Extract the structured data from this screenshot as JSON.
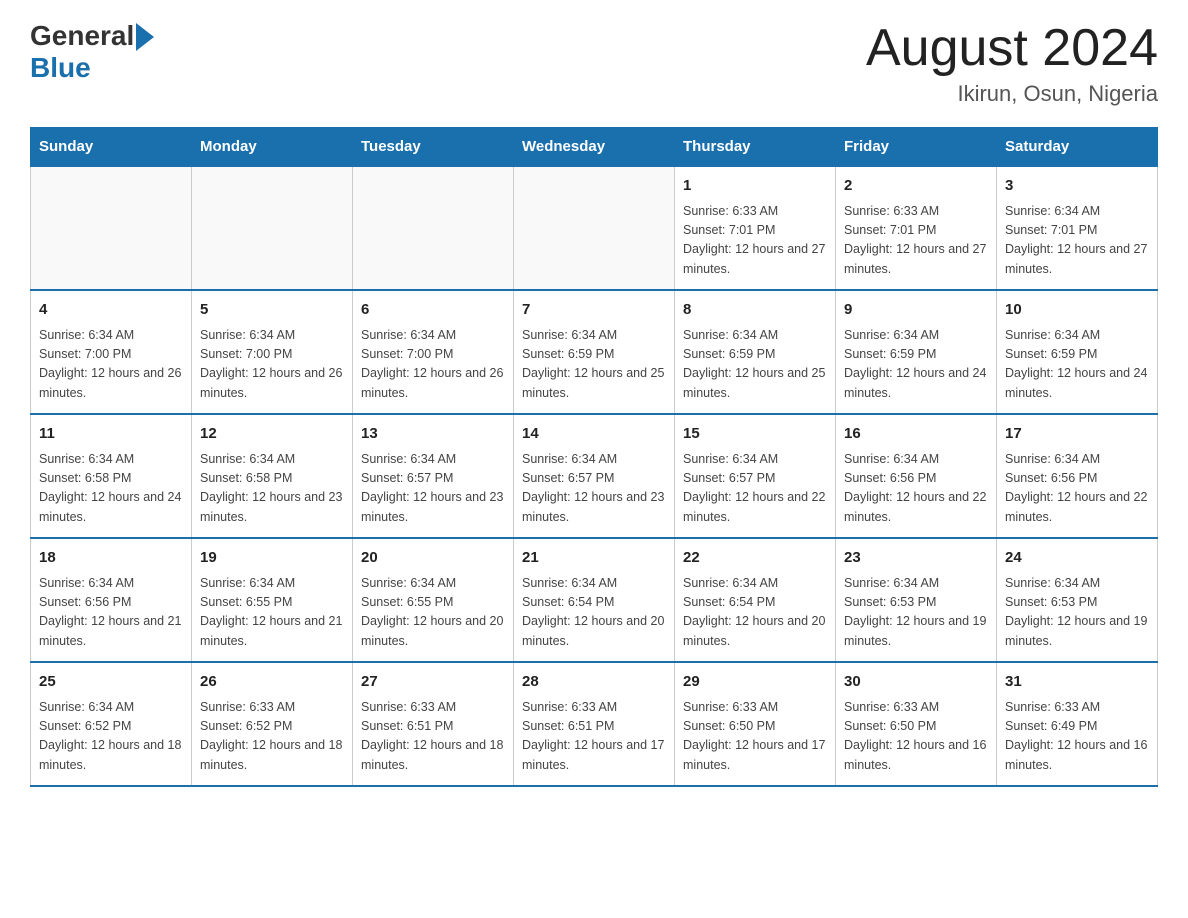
{
  "header": {
    "logo_general": "General",
    "logo_blue": "Blue",
    "title": "August 2024",
    "subtitle": "Ikirun, Osun, Nigeria"
  },
  "calendar": {
    "days_of_week": [
      "Sunday",
      "Monday",
      "Tuesday",
      "Wednesday",
      "Thursday",
      "Friday",
      "Saturday"
    ],
    "weeks": [
      [
        {
          "day": "",
          "info": ""
        },
        {
          "day": "",
          "info": ""
        },
        {
          "day": "",
          "info": ""
        },
        {
          "day": "",
          "info": ""
        },
        {
          "day": "1",
          "info": "Sunrise: 6:33 AM\nSunset: 7:01 PM\nDaylight: 12 hours and 27 minutes."
        },
        {
          "day": "2",
          "info": "Sunrise: 6:33 AM\nSunset: 7:01 PM\nDaylight: 12 hours and 27 minutes."
        },
        {
          "day": "3",
          "info": "Sunrise: 6:34 AM\nSunset: 7:01 PM\nDaylight: 12 hours and 27 minutes."
        }
      ],
      [
        {
          "day": "4",
          "info": "Sunrise: 6:34 AM\nSunset: 7:00 PM\nDaylight: 12 hours and 26 minutes."
        },
        {
          "day": "5",
          "info": "Sunrise: 6:34 AM\nSunset: 7:00 PM\nDaylight: 12 hours and 26 minutes."
        },
        {
          "day": "6",
          "info": "Sunrise: 6:34 AM\nSunset: 7:00 PM\nDaylight: 12 hours and 26 minutes."
        },
        {
          "day": "7",
          "info": "Sunrise: 6:34 AM\nSunset: 6:59 PM\nDaylight: 12 hours and 25 minutes."
        },
        {
          "day": "8",
          "info": "Sunrise: 6:34 AM\nSunset: 6:59 PM\nDaylight: 12 hours and 25 minutes."
        },
        {
          "day": "9",
          "info": "Sunrise: 6:34 AM\nSunset: 6:59 PM\nDaylight: 12 hours and 24 minutes."
        },
        {
          "day": "10",
          "info": "Sunrise: 6:34 AM\nSunset: 6:59 PM\nDaylight: 12 hours and 24 minutes."
        }
      ],
      [
        {
          "day": "11",
          "info": "Sunrise: 6:34 AM\nSunset: 6:58 PM\nDaylight: 12 hours and 24 minutes."
        },
        {
          "day": "12",
          "info": "Sunrise: 6:34 AM\nSunset: 6:58 PM\nDaylight: 12 hours and 23 minutes."
        },
        {
          "day": "13",
          "info": "Sunrise: 6:34 AM\nSunset: 6:57 PM\nDaylight: 12 hours and 23 minutes."
        },
        {
          "day": "14",
          "info": "Sunrise: 6:34 AM\nSunset: 6:57 PM\nDaylight: 12 hours and 23 minutes."
        },
        {
          "day": "15",
          "info": "Sunrise: 6:34 AM\nSunset: 6:57 PM\nDaylight: 12 hours and 22 minutes."
        },
        {
          "day": "16",
          "info": "Sunrise: 6:34 AM\nSunset: 6:56 PM\nDaylight: 12 hours and 22 minutes."
        },
        {
          "day": "17",
          "info": "Sunrise: 6:34 AM\nSunset: 6:56 PM\nDaylight: 12 hours and 22 minutes."
        }
      ],
      [
        {
          "day": "18",
          "info": "Sunrise: 6:34 AM\nSunset: 6:56 PM\nDaylight: 12 hours and 21 minutes."
        },
        {
          "day": "19",
          "info": "Sunrise: 6:34 AM\nSunset: 6:55 PM\nDaylight: 12 hours and 21 minutes."
        },
        {
          "day": "20",
          "info": "Sunrise: 6:34 AM\nSunset: 6:55 PM\nDaylight: 12 hours and 20 minutes."
        },
        {
          "day": "21",
          "info": "Sunrise: 6:34 AM\nSunset: 6:54 PM\nDaylight: 12 hours and 20 minutes."
        },
        {
          "day": "22",
          "info": "Sunrise: 6:34 AM\nSunset: 6:54 PM\nDaylight: 12 hours and 20 minutes."
        },
        {
          "day": "23",
          "info": "Sunrise: 6:34 AM\nSunset: 6:53 PM\nDaylight: 12 hours and 19 minutes."
        },
        {
          "day": "24",
          "info": "Sunrise: 6:34 AM\nSunset: 6:53 PM\nDaylight: 12 hours and 19 minutes."
        }
      ],
      [
        {
          "day": "25",
          "info": "Sunrise: 6:34 AM\nSunset: 6:52 PM\nDaylight: 12 hours and 18 minutes."
        },
        {
          "day": "26",
          "info": "Sunrise: 6:33 AM\nSunset: 6:52 PM\nDaylight: 12 hours and 18 minutes."
        },
        {
          "day": "27",
          "info": "Sunrise: 6:33 AM\nSunset: 6:51 PM\nDaylight: 12 hours and 18 minutes."
        },
        {
          "day": "28",
          "info": "Sunrise: 6:33 AM\nSunset: 6:51 PM\nDaylight: 12 hours and 17 minutes."
        },
        {
          "day": "29",
          "info": "Sunrise: 6:33 AM\nSunset: 6:50 PM\nDaylight: 12 hours and 17 minutes."
        },
        {
          "day": "30",
          "info": "Sunrise: 6:33 AM\nSunset: 6:50 PM\nDaylight: 12 hours and 16 minutes."
        },
        {
          "day": "31",
          "info": "Sunrise: 6:33 AM\nSunset: 6:49 PM\nDaylight: 12 hours and 16 minutes."
        }
      ]
    ]
  }
}
